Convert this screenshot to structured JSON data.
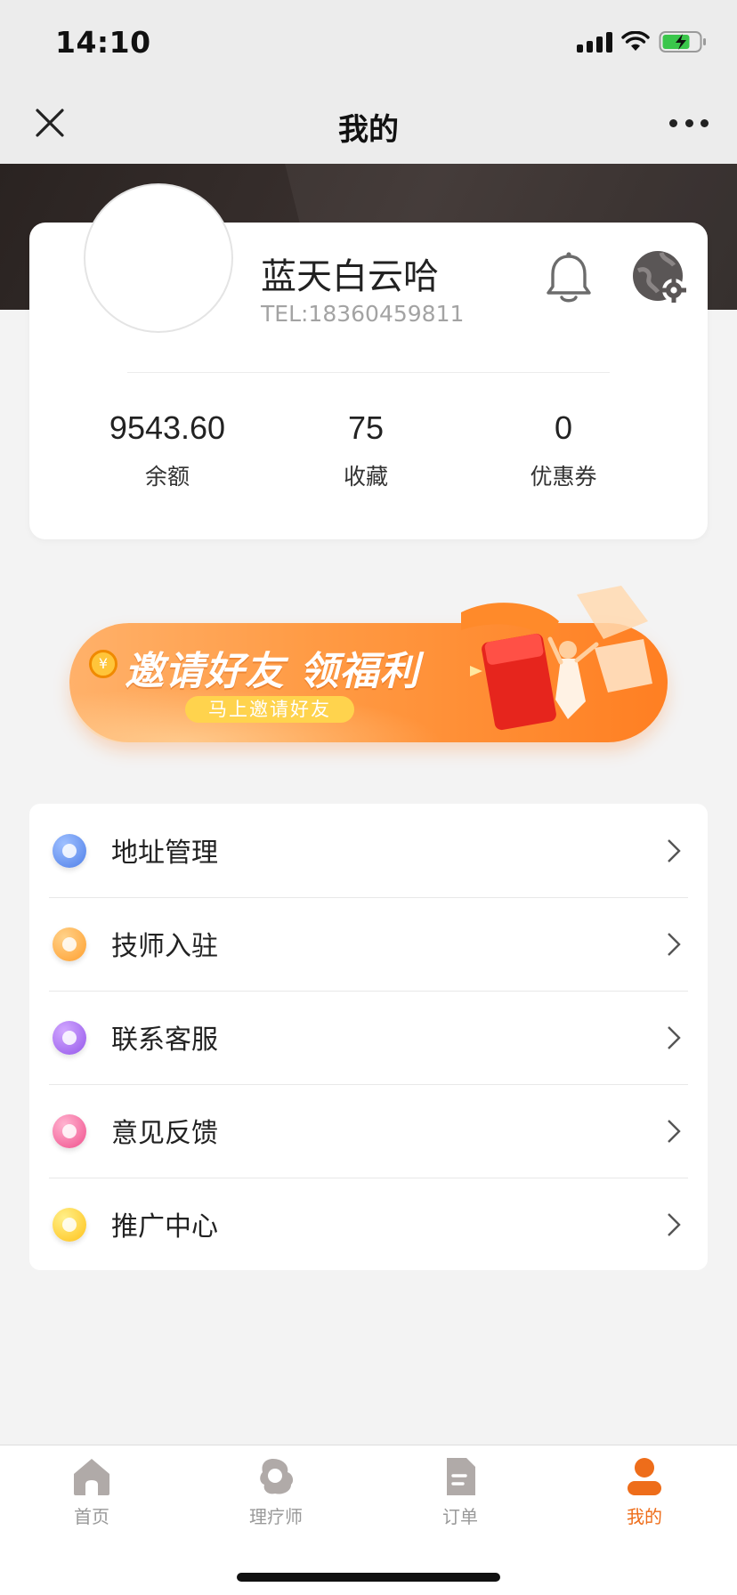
{
  "status_bar": {
    "time": "14:10"
  },
  "nav": {
    "title": "我的"
  },
  "profile": {
    "name": "蓝天白云哈",
    "tel": "TEL:18360459811"
  },
  "stats": [
    {
      "value": "9543.60",
      "label": "余额"
    },
    {
      "value": "75",
      "label": "收藏"
    },
    {
      "value": "0",
      "label": "优惠券"
    }
  ],
  "banner": {
    "title": "邀请好友 领福利",
    "button": "马上邀请好友"
  },
  "menu": [
    {
      "label": "地址管理",
      "icon": "location-icon",
      "color": "#5b8def"
    },
    {
      "label": "技师入驻",
      "icon": "technician-icon",
      "color": "#ffad3b"
    },
    {
      "label": "联系客服",
      "icon": "customer-service-icon",
      "color": "#a56bf0"
    },
    {
      "label": "意见反馈",
      "icon": "feedback-icon",
      "color": "#f2609a"
    },
    {
      "label": "推广中心",
      "icon": "gift-icon",
      "color": "#ffcc2e"
    }
  ],
  "tabs": [
    {
      "label": "首页",
      "icon": "home-icon",
      "active": false
    },
    {
      "label": "理疗师",
      "icon": "therapist-icon",
      "active": false
    },
    {
      "label": "订单",
      "icon": "order-icon",
      "active": false
    },
    {
      "label": "我的",
      "icon": "profile-icon",
      "active": true
    }
  ],
  "colors": {
    "accent": "#ee6d1a",
    "inactive_tab": "#b0aaa8",
    "header": "#2f2826"
  }
}
